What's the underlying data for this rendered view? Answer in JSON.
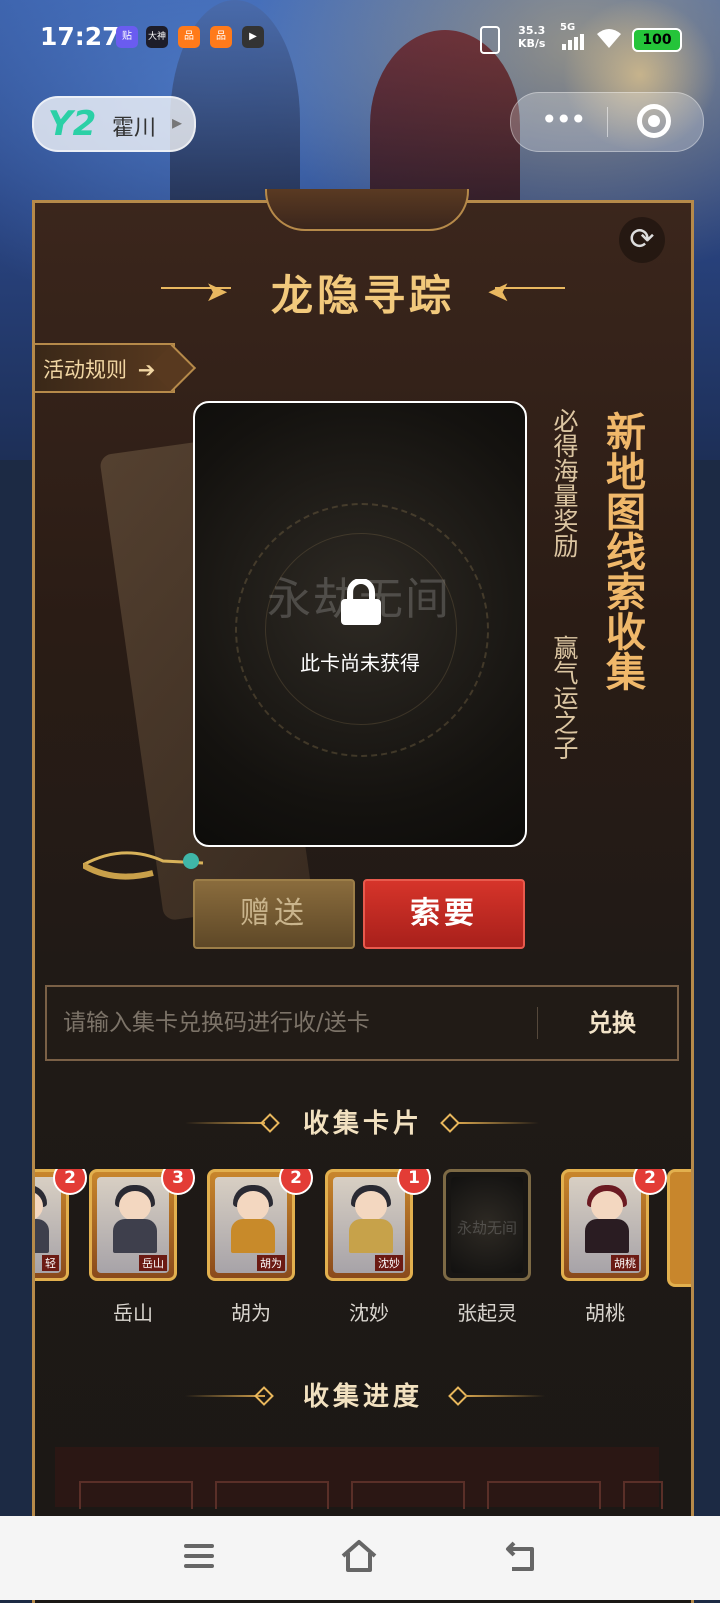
{
  "status_bar": {
    "time": "17:27",
    "app_icons": [
      "贴",
      "大神",
      "品",
      "品",
      "▶"
    ],
    "net_speed": "35.3",
    "net_unit": "KB/s",
    "signal": "5G",
    "battery": "100"
  },
  "top_bar": {
    "user_name": "霍川",
    "user_logo": "Y2",
    "more_icon": "more-dots-icon",
    "close_icon": "target-icon"
  },
  "panel": {
    "title": "龙隐寻踪",
    "rules_button": "活动规则",
    "card": {
      "logo": "永劫无间",
      "locked_text": "此卡尚未获得"
    },
    "slogan_main": "新地图线索收集",
    "slogan_sub_1": "必得海量奖励",
    "slogan_sub_2": "赢气运之子",
    "gift_button": "赠送",
    "ask_button": "索要",
    "code_input": {
      "placeholder": "请输入集卡兑换码进行收/送卡",
      "value": ""
    },
    "redeem_button": "兑换",
    "collect_title": "收集卡片",
    "progress_title": "收集进度",
    "cards": [
      {
        "name": "",
        "tag": "轻",
        "count": "2",
        "locked": false
      },
      {
        "name": "岳山",
        "tag": "岳山",
        "count": "3",
        "locked": false
      },
      {
        "name": "胡为",
        "tag": "胡为",
        "count": "2",
        "locked": false
      },
      {
        "name": "沈妙",
        "tag": "沈妙",
        "count": "1",
        "locked": false
      },
      {
        "name": "张起灵",
        "tag": "",
        "count": "",
        "locked": true
      },
      {
        "name": "胡桃",
        "tag": "胡桃",
        "count": "2",
        "locked": false
      }
    ]
  },
  "colors": {
    "accent_gold": "#f2c97c",
    "ask_red": "#d6342a",
    "badge_red": "#e33c36"
  }
}
